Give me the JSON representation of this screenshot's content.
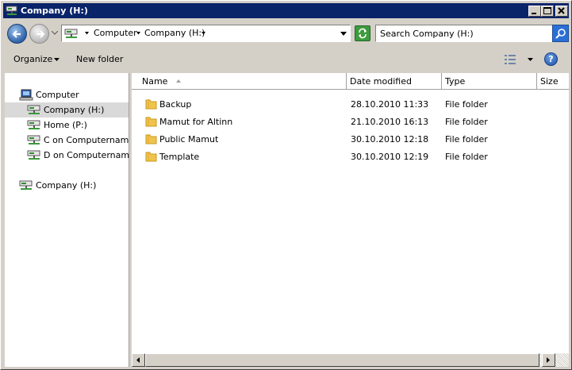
{
  "window": {
    "title": "Company (H:)",
    "minimize_icon": "minimize-icon",
    "maximize_icon": "maximize-icon",
    "close_icon": "close-icon"
  },
  "address": {
    "breadcrumbs": [
      "Computer",
      "Company (H:)"
    ],
    "drive_icon": "network-drive-icon"
  },
  "search": {
    "placeholder": "Search Company (H:)"
  },
  "toolbar": {
    "organize_label": "Organize",
    "new_folder_label": "New folder",
    "views_icon": "views-icon",
    "help_icon": "help-icon",
    "help_glyph": "?"
  },
  "navigation": {
    "items": [
      {
        "label": "Computer",
        "icon": "computer-icon"
      },
      {
        "label": "Company (H:)",
        "icon": "network-drive-icon",
        "selected": true
      },
      {
        "label": "Home (P:)",
        "icon": "network-drive-icon"
      },
      {
        "label": "C on Computername",
        "icon": "network-drive-icon"
      },
      {
        "label": "D on Computername",
        "icon": "network-drive-icon"
      },
      {
        "label": "Company (H:)",
        "icon": "network-drive-icon"
      }
    ]
  },
  "file_list": {
    "columns": [
      "Name",
      "Date modified",
      "Type",
      "Size"
    ],
    "sorted_by": "Name",
    "rows": [
      {
        "name": "Backup",
        "date": "28.10.2010 11:33",
        "type": "File folder",
        "icon": "folder-icon"
      },
      {
        "name": "Mamut for Altinn",
        "date": "21.10.2010 16:13",
        "type": "File folder",
        "icon": "folder-icon"
      },
      {
        "name": "Public Mamut",
        "date": "30.10.2010 12:18",
        "type": "File folder",
        "icon": "folder-icon"
      },
      {
        "name": "Template",
        "date": "30.10.2010 12:19",
        "type": "File folder",
        "icon": "folder-icon"
      }
    ]
  },
  "colors": {
    "titlebar": "#0a246a",
    "chrome": "#d4d0c8",
    "selected_item": "#d9d9d9",
    "folder": "#f0c44c"
  }
}
